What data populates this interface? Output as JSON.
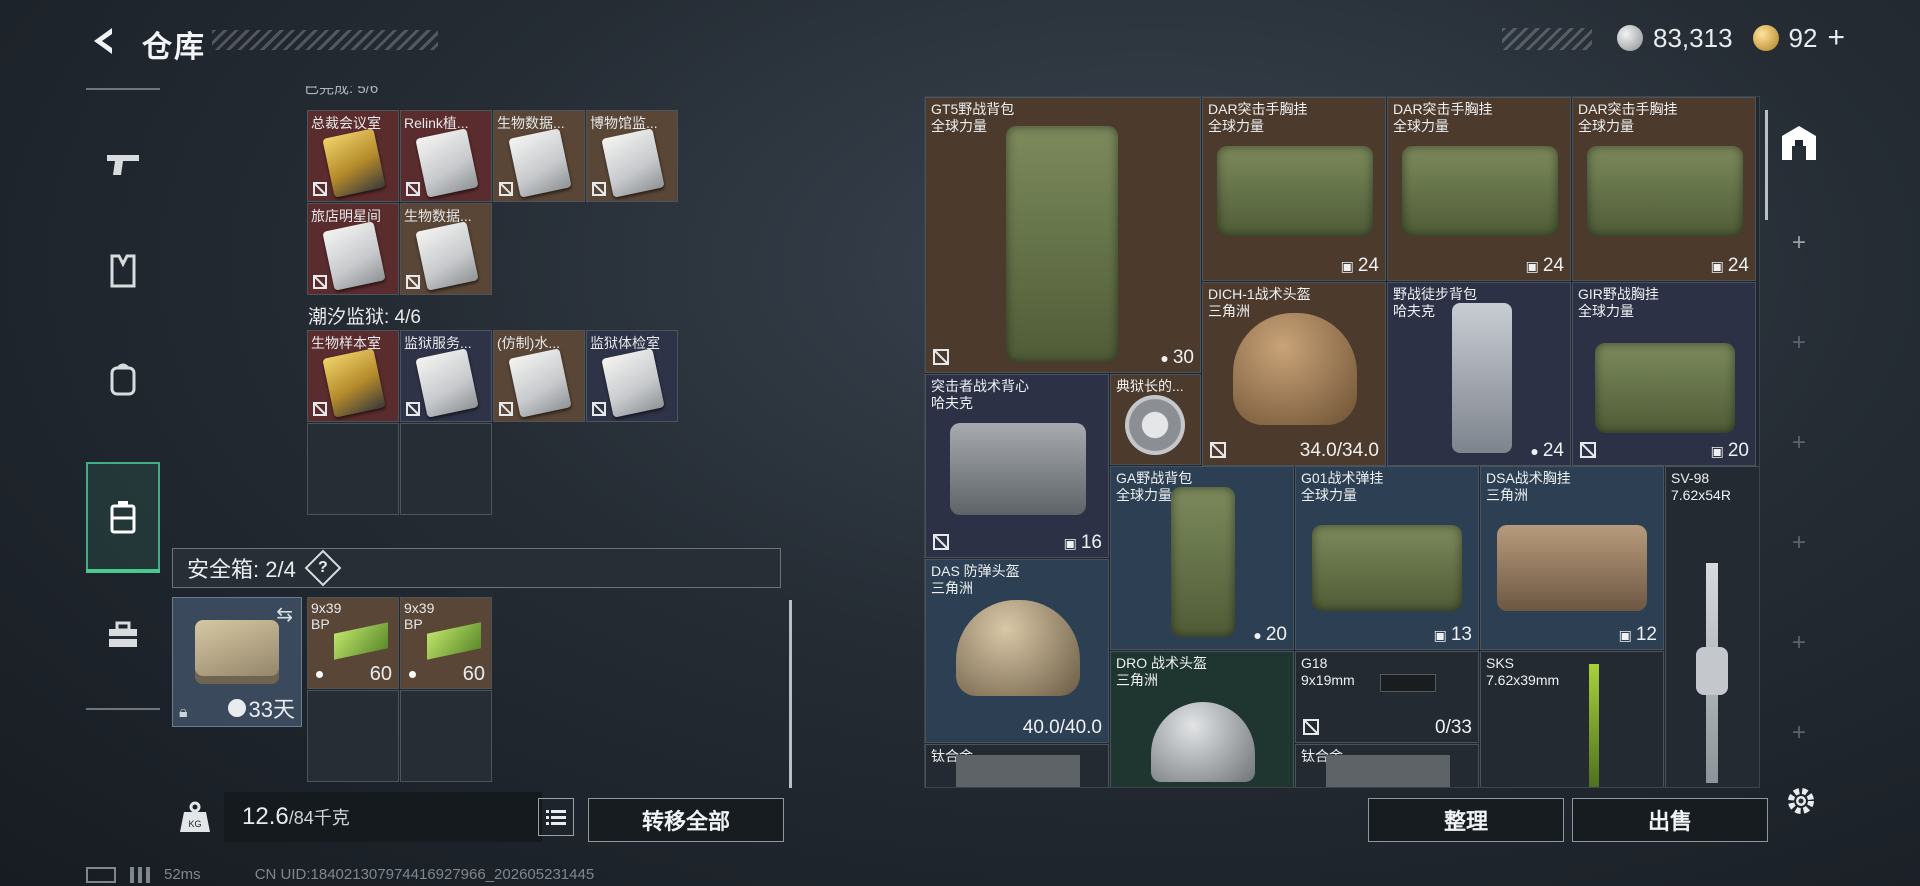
{
  "header": {
    "title": "仓库"
  },
  "currency": {
    "silver": "83,313",
    "gold": "92"
  },
  "left": {
    "top_partial": "已完成: 5/6",
    "row1": [
      {
        "label": "总裁会议室",
        "bg": "maroon",
        "card": "gold"
      },
      {
        "label": "Relink植...",
        "bg": "maroon",
        "card": "white"
      },
      {
        "label": "生物数据...",
        "bg": "tan",
        "card": "white"
      },
      {
        "label": "博物馆监...",
        "bg": "tan",
        "card": "white"
      }
    ],
    "row2": [
      {
        "label": "旅店明星间",
        "bg": "maroon",
        "card": "white"
      },
      {
        "label": "生物数据...",
        "bg": "tan",
        "card": "white"
      }
    ],
    "section2_title": "潮汐监狱: 4/6",
    "row3": [
      {
        "label": "生物样本室",
        "bg": "maroon",
        "card": "gold"
      },
      {
        "label": "监狱服务...",
        "bg": "navy",
        "card": "white"
      },
      {
        "label": "(仿制)水...",
        "bg": "tan",
        "card": "white"
      },
      {
        "label": "监狱体检室",
        "bg": "navy",
        "card": "white"
      }
    ],
    "safebox_label": "安全箱: 2/4",
    "safebox_days": "33天",
    "ammo": [
      {
        "name": "9x39",
        "sub": "BP",
        "count": "60"
      },
      {
        "name": "9x39",
        "sub": "BP",
        "count": "60"
      }
    ],
    "weight_current": "12.6",
    "weight_max": "/84千克",
    "transfer_all": "转移全部"
  },
  "right": {
    "items": {
      "gt5": {
        "name": "GT5野战背包",
        "sub": "全球力量",
        "count": "30"
      },
      "dar1": {
        "name": "DAR突击手胸挂",
        "sub": "全球力量",
        "count": "24"
      },
      "dar2": {
        "name": "DAR突击手胸挂",
        "sub": "全球力量",
        "count": "24"
      },
      "dar3": {
        "name": "DAR突击手胸挂",
        "sub": "全球力量",
        "count": "24"
      },
      "dich": {
        "name": "DICH-1战术头盔",
        "sub": "三角洲",
        "count": "34.0/34.0"
      },
      "hike": {
        "name": "野战徒步背包",
        "sub": "哈夫克",
        "count": "24"
      },
      "gir": {
        "name": "GIR野战胸挂",
        "sub": "全球力量",
        "count": "20"
      },
      "assault": {
        "name": "突击者战术背心",
        "sub": "哈夫克",
        "count": "16"
      },
      "token": {
        "name": "典狱长的...",
        "sub": ""
      },
      "ga": {
        "name": "GA野战背包",
        "sub": "全球力量",
        "count": "20"
      },
      "g01": {
        "name": "G01战术弹挂",
        "sub": "全球力量",
        "count": "13"
      },
      "dsa": {
        "name": "DSA战术胸挂",
        "sub": "三角洲",
        "count": "12"
      },
      "sv98": {
        "name": "SV-98",
        "sub": "7.62x54R"
      },
      "das": {
        "name": "DAS 防弹头盔",
        "sub": "三角洲",
        "count": "40.0/40.0"
      },
      "dro": {
        "name": "DRO 战术头盔",
        "sub": "三角洲"
      },
      "g18": {
        "name": "G18",
        "sub": "9x19mm",
        "count": "0/33"
      },
      "sks": {
        "name": "SKS",
        "sub": "7.62x39mm"
      },
      "ti1": {
        "name": "钛合金"
      },
      "ti2": {
        "name": "钛合金"
      }
    },
    "sort_button": "整理",
    "sell_button": "出售"
  },
  "status": {
    "ping": "52ms",
    "uid": "CN UID:184021307974416927966_202605231445"
  }
}
